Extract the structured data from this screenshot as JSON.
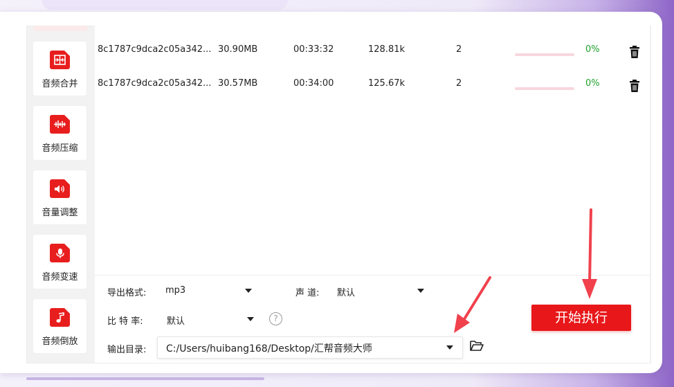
{
  "sidebar": {
    "items": [
      {
        "label": "音频合并",
        "icon": "merge-icon"
      },
      {
        "label": "音频压缩",
        "icon": "compress-waveform-icon"
      },
      {
        "label": "音量调整",
        "icon": "speaker-volume-icon"
      },
      {
        "label": "音频变速",
        "icon": "microphone-icon"
      },
      {
        "label": "音频倒放",
        "icon": "music-note-icon"
      }
    ]
  },
  "files": [
    {
      "name": "8c1787c9dca2c05a342...",
      "size": "30.90MB",
      "duration": "00:33:32",
      "bitrate": "128.81k",
      "channels": "2",
      "progress": 0,
      "percent": "0%"
    },
    {
      "name": "8c1787c9dca2c05a342...",
      "size": "30.57MB",
      "duration": "00:34:00",
      "bitrate": "125.67k",
      "channels": "2",
      "progress": 0,
      "percent": "0%"
    }
  ],
  "settings": {
    "format_label": "导出格式:",
    "format_value": "mp3",
    "channel_label": "声 道:",
    "channel_value": "默认",
    "bitrate_label": "比 特 率:",
    "bitrate_value": "默认",
    "help_glyph": "?",
    "output_label": "输出目录:",
    "output_path": "C:/Users/huibang168/Desktop/汇帮音频大师"
  },
  "start_button": "开始执行",
  "colors": {
    "accent": "#e8171a",
    "progress_text": "#1fa02b",
    "progress_track": "#f8d7de",
    "annotation_arrow": "#f0414d"
  }
}
